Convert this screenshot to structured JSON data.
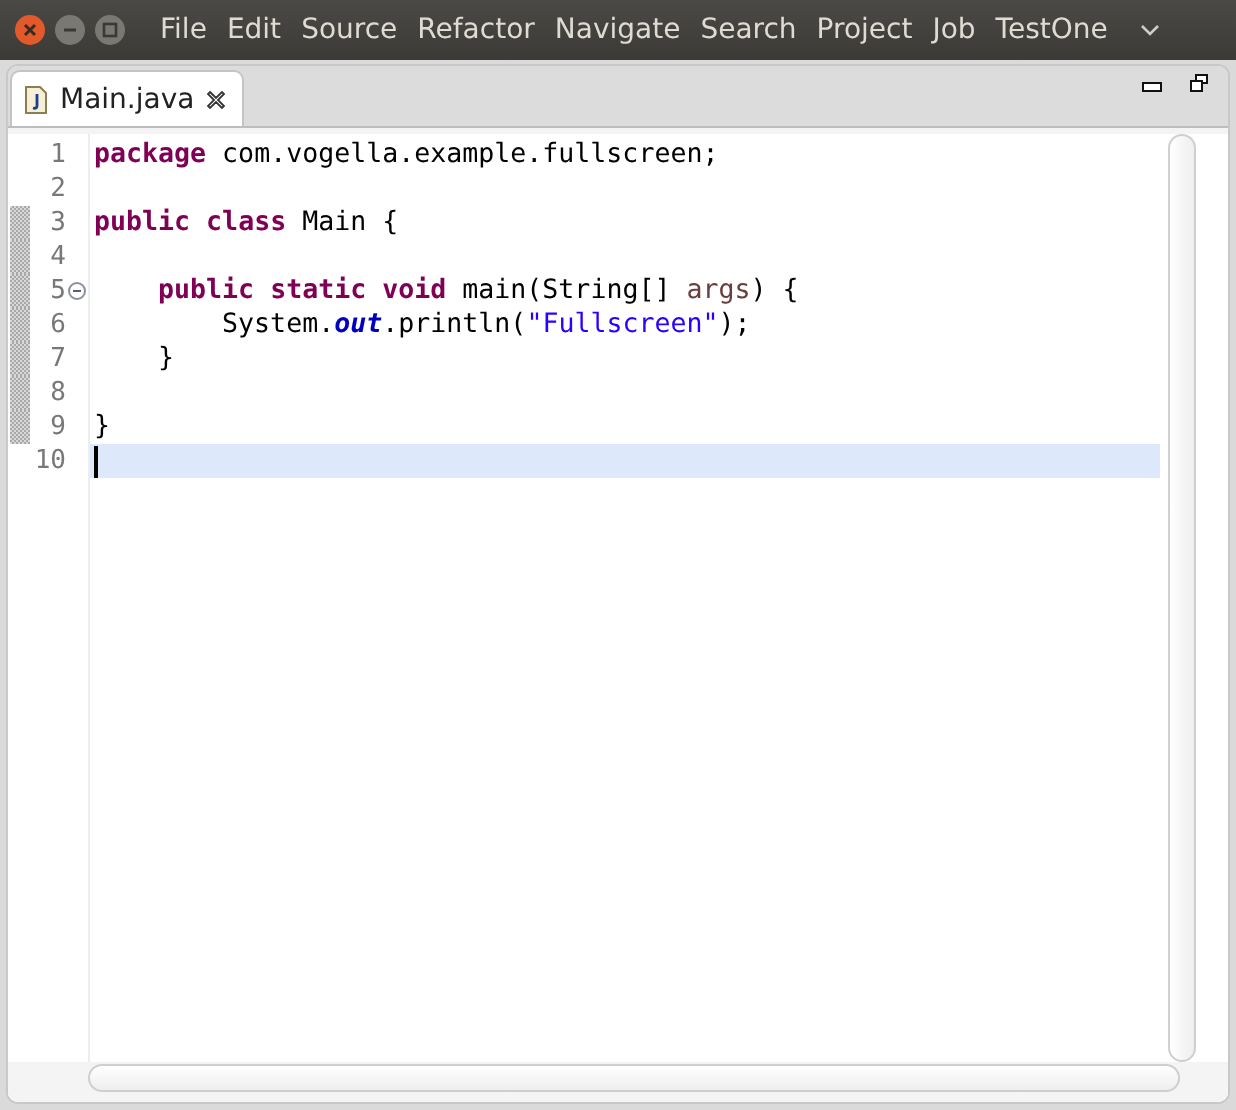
{
  "window": {
    "menu": [
      "File",
      "Edit",
      "Source",
      "Refactor",
      "Navigate",
      "Search",
      "Project",
      "Job",
      "TestOne"
    ]
  },
  "tabs": [
    {
      "label": "Main.java",
      "selected": true
    }
  ],
  "editor": {
    "lines": [
      {
        "number": "1",
        "changed": false,
        "current": false,
        "fold": false,
        "tokens": [
          {
            "kind": "keyword",
            "text": "package"
          },
          {
            "kind": "plain",
            "text": " com.vogella.example.fullscreen;"
          }
        ]
      },
      {
        "number": "2",
        "changed": false,
        "current": false,
        "fold": false
      },
      {
        "number": "3",
        "changed": true,
        "current": false,
        "fold": false,
        "tokens": [
          {
            "kind": "keyword",
            "text": "public"
          },
          {
            "kind": "keyword",
            "text": " class"
          },
          {
            "kind": "plain",
            "text": " Main {"
          }
        ]
      },
      {
        "number": "4",
        "changed": true,
        "current": false,
        "fold": false
      },
      {
        "number": "5",
        "changed": true,
        "current": false,
        "fold": true,
        "tokens": [
          {
            "kind": "keyword",
            "text": "    public"
          },
          {
            "kind": "keyword",
            "text": " static"
          },
          {
            "kind": "keyword",
            "text": " void"
          },
          {
            "kind": "plain",
            "text": " main(String[] "
          },
          {
            "kind": "param",
            "text": "args"
          },
          {
            "kind": "plain",
            "text": ") {"
          }
        ]
      },
      {
        "number": "6",
        "changed": true,
        "current": false,
        "fold": false,
        "tokens": [
          {
            "kind": "plain",
            "text": "        System."
          },
          {
            "kind": "field",
            "text": "out"
          },
          {
            "kind": "plain",
            "text": ".println("
          },
          {
            "kind": "string",
            "text": "\"Fullscreen\""
          },
          {
            "kind": "plain",
            "text": ");"
          }
        ]
      },
      {
        "number": "7",
        "changed": true,
        "current": false,
        "fold": false,
        "tokens": [
          {
            "kind": "plain",
            "text": "    }"
          }
        ]
      },
      {
        "number": "8",
        "changed": true,
        "current": false,
        "fold": false
      },
      {
        "number": "9",
        "changed": true,
        "current": false,
        "fold": false,
        "tokens": [
          {
            "kind": "plain",
            "text": "}"
          }
        ]
      },
      {
        "number": "10",
        "changed": false,
        "current": true,
        "fold": false
      }
    ]
  }
}
